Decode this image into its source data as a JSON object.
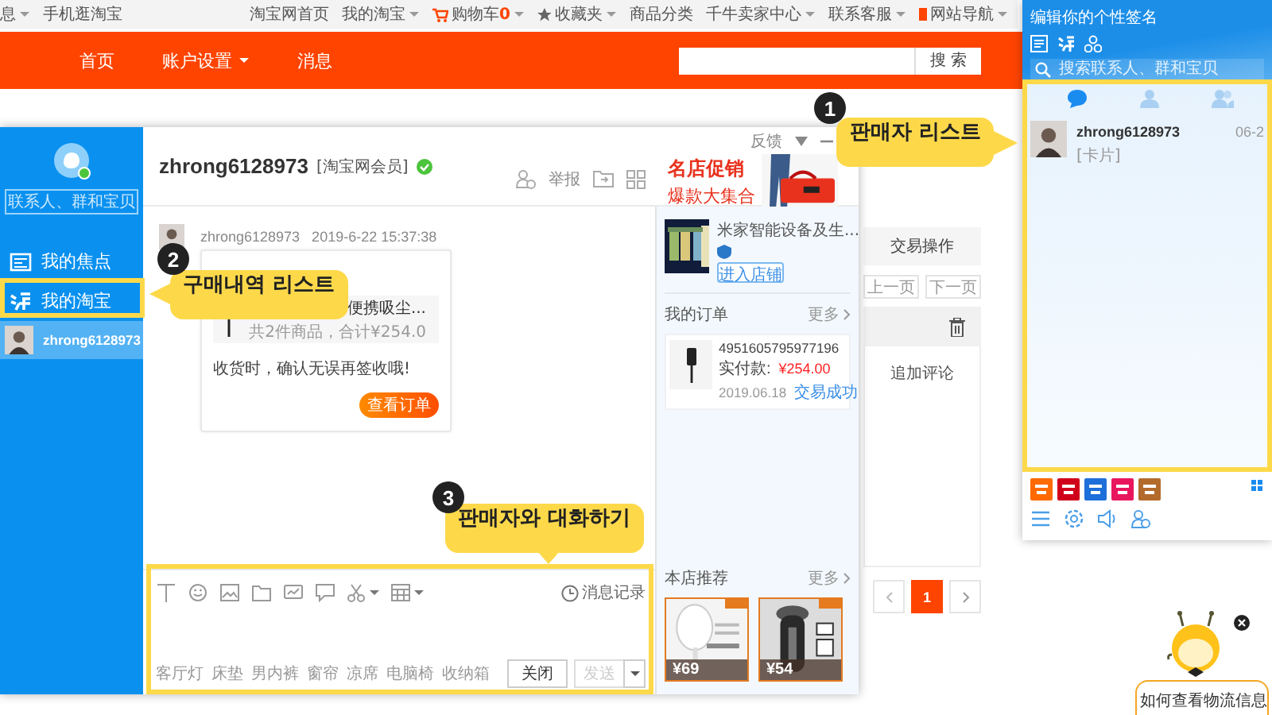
{
  "top_bar": {
    "left_links": [
      {
        "label": "息",
        "caret": true
      },
      {
        "label": "手机逛淘宝",
        "caret": false
      }
    ],
    "right_links": [
      {
        "label": "淘宝网首页",
        "kind": "plain",
        "caret": false
      },
      {
        "label": "我的淘宝",
        "kind": "plain",
        "caret": true
      },
      {
        "label": "购物车",
        "count": "0",
        "kind": "cart",
        "caret": true
      },
      {
        "label": "收藏夹",
        "kind": "star",
        "caret": true
      },
      {
        "label": "商品分类",
        "kind": "plain",
        "caret": false
      },
      {
        "label": "千牛卖家中心",
        "kind": "plain",
        "caret": true
      },
      {
        "label": "联系客服",
        "kind": "plain",
        "caret": true
      },
      {
        "label": "网站导航",
        "kind": "nav",
        "caret": true
      }
    ]
  },
  "nav": {
    "items": [
      {
        "label": "首页",
        "caret": false
      },
      {
        "label": "账户设置",
        "caret": true
      },
      {
        "label": "消息",
        "caret": false
      }
    ],
    "search_button": "搜 索"
  },
  "orders_page": {
    "column": "交易操作",
    "prev": "上一页",
    "next": "下一页",
    "action": "追加评论",
    "pages": [
      {
        "label": "1",
        "selected": true
      }
    ]
  },
  "chat_window": {
    "sidebar": {
      "search_placeholder": "联系人、群和宝贝",
      "items": [
        {
          "kind": "focus",
          "label": "我的焦点",
          "selected": false
        },
        {
          "kind": "taobao",
          "label": "我的淘宝",
          "selected": false
        },
        {
          "kind": "contact",
          "label": "zhrong6128973",
          "selected": true
        }
      ]
    },
    "header": {
      "name": "zhrong6128973",
      "badge": "[淘宝网会员]",
      "verified": true,
      "report": "举报",
      "feedback": "反馈"
    },
    "ad": {
      "line1": "名店促销",
      "line2": "爆款大集合"
    },
    "message": {
      "sender": "zhrong6128973",
      "time": "2019-6-22 15:37:38",
      "card": {
        "product": "便携吸尘...",
        "summary": "共2件商品，合计¥254.0",
        "note": "收货时，确认无误再签收哦!",
        "button": "查看订单"
      }
    },
    "input": {
      "history": "消息记录",
      "quick_phrases": [
        "客厅灯",
        "床垫",
        "男内裤",
        "窗帘",
        "凉席",
        "电脑椅",
        "收纳箱"
      ],
      "close": "关闭",
      "send": {
        "label": "发送",
        "disabled": true
      }
    },
    "shop": {
      "name": "米家智能设备及生...",
      "enter": "进入店铺",
      "orders_title": "我的订单",
      "orders_more": "更多",
      "order": {
        "number": "4951605795977196",
        "paid_label": "实付款:",
        "paid": "¥254.00",
        "date": "2019.06.18",
        "status": "交易成功"
      },
      "recommend_title": "本店推荐",
      "recommend_more": "更多",
      "products": [
        {
          "price": "¥69"
        },
        {
          "price": "¥54"
        }
      ]
    }
  },
  "messenger": {
    "signature": "编辑你的个性签名",
    "search_placeholder": "搜索联系人、群和宝贝",
    "tabs": [
      {
        "kind": "chat",
        "selected": true
      },
      {
        "kind": "contacts",
        "selected": false
      },
      {
        "kind": "groups",
        "selected": false
      }
    ],
    "contacts": [
      {
        "name": "zhrong6128973",
        "date": "06-2",
        "preview": "[卡片]"
      }
    ],
    "apps": [
      {
        "color": "#ff6a00"
      },
      {
        "color": "#d0021b"
      },
      {
        "color": "#1e6fd9"
      },
      {
        "color": "#e8175d"
      },
      {
        "color": "#b36b2c"
      }
    ]
  },
  "mascot": {
    "bubble": "如何查看物流信息"
  },
  "annotations": [
    {
      "number": "1",
      "text": "판매자 리스트"
    },
    {
      "number": "2",
      "text": "구매내역 리스트"
    },
    {
      "number": "3",
      "text": "판매자와 대화하기"
    }
  ]
}
